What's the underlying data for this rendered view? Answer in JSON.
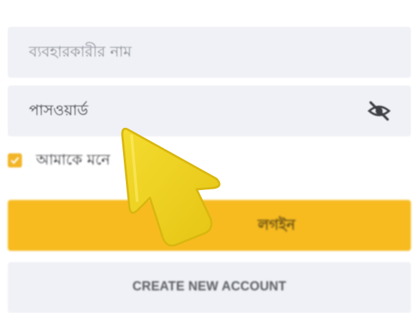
{
  "login_form": {
    "username": {
      "placeholder": "ব্যবহারকারীর নাম",
      "value": ""
    },
    "password": {
      "value": "পাসওয়ার্ড",
      "toggle_icon": "eye-off-icon"
    },
    "remember_me": {
      "label": "আমাকে মনে",
      "checked": true
    },
    "login_button": {
      "label": "লগইন"
    },
    "create_account_button": {
      "label": "CREATE NEW ACCOUNT"
    }
  },
  "overlay": {
    "pointer_icon": "arrow-cursor-icon",
    "color": "#f1d11c"
  },
  "colors": {
    "accent": "#f7bb20",
    "field_bg": "#eff1f6",
    "checkbox": "#f2b527"
  }
}
